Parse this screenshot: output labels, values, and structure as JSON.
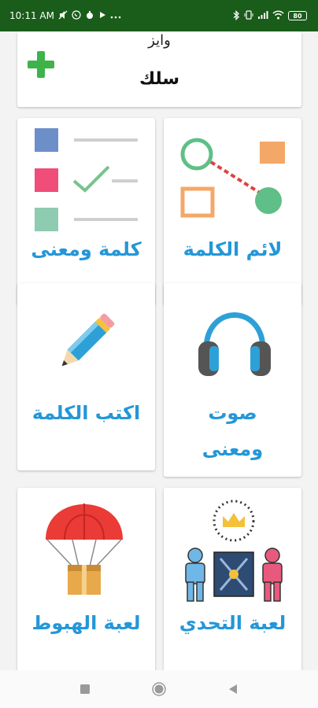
{
  "status_bar": {
    "time": "10:11 AM",
    "battery": "80",
    "icons": [
      "mute-icon",
      "whatsapp-icon",
      "app-icon",
      "play-icon",
      "more-dots-icon",
      "bluetooth-icon",
      "vibrate-icon",
      "signal-icon",
      "wifi-icon",
      "battery-icon"
    ]
  },
  "header_card": {
    "subtitle": "وايز",
    "title": "سلك",
    "add_icon": "plus-icon"
  },
  "tiles": [
    {
      "id": "word-meaning",
      "label": "كلمة ومعنى",
      "icon": "checklist-icon"
    },
    {
      "id": "match-word",
      "label": "لائم الكلمة",
      "icon": "match-shapes-icon"
    },
    {
      "id": "write-word",
      "label": "اكتب الكلمة",
      "icon": "pencil-icon"
    },
    {
      "id": "sound-meaning",
      "label": "صوت ومعنى",
      "label_line1": "صوت",
      "label_line2": "ومعنى",
      "icon": "headphones-icon"
    },
    {
      "id": "landing-game",
      "label": "لعبة الهبوط",
      "icon": "parachute-icon"
    },
    {
      "id": "challenge-game",
      "label": "لعبة التحدي",
      "icon": "challenge-icon"
    }
  ],
  "colors": {
    "status_bar": "#1a5c1a",
    "accent_text": "#2497d8",
    "plus": "#3db34a"
  },
  "nav_bar": {
    "icons": [
      "recent-apps-icon",
      "home-icon",
      "back-icon"
    ]
  }
}
